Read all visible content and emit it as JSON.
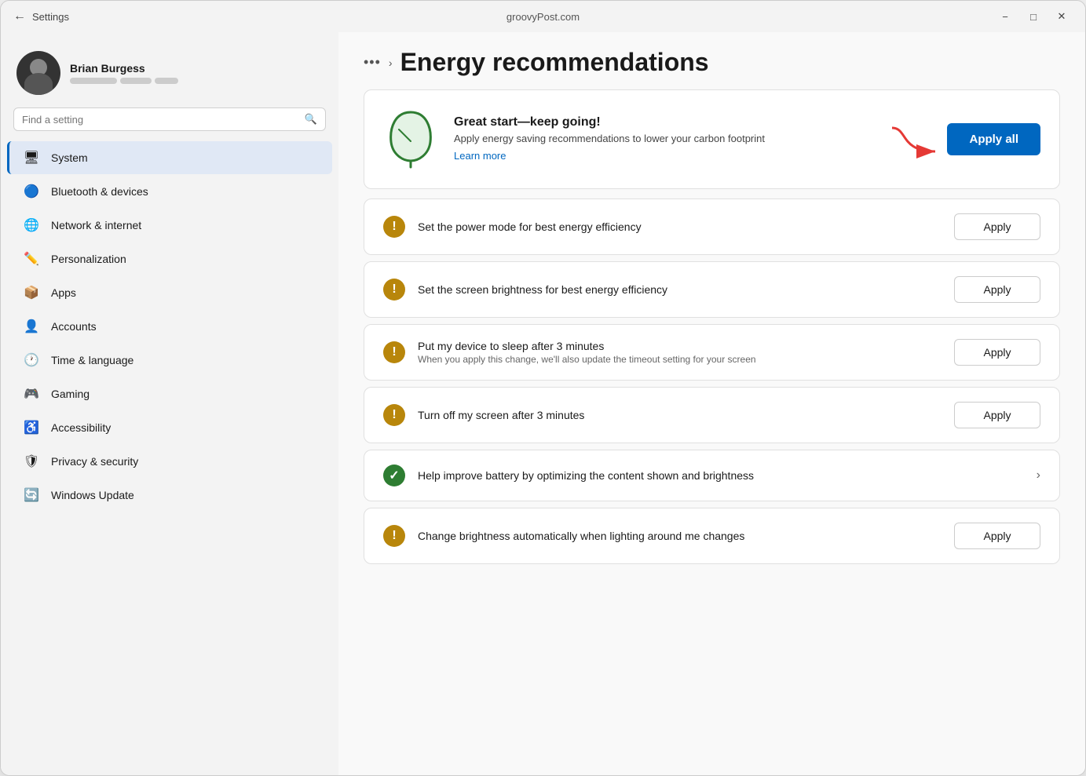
{
  "window": {
    "title": "groovyPost.com",
    "controls": {
      "minimize": "−",
      "maximize": "□",
      "close": "✕"
    }
  },
  "sidebar": {
    "user": {
      "name": "Brian Burgess",
      "bars": [
        60,
        40,
        30
      ]
    },
    "search": {
      "placeholder": "Find a setting"
    },
    "nav": [
      {
        "id": "system",
        "label": "System",
        "icon": "🖥",
        "active": true
      },
      {
        "id": "bluetooth",
        "label": "Bluetooth & devices",
        "icon": "🔵"
      },
      {
        "id": "network",
        "label": "Network & internet",
        "icon": "🌐"
      },
      {
        "id": "personalization",
        "label": "Personalization",
        "icon": "✏️"
      },
      {
        "id": "apps",
        "label": "Apps",
        "icon": "📦"
      },
      {
        "id": "accounts",
        "label": "Accounts",
        "icon": "👤"
      },
      {
        "id": "time",
        "label": "Time & language",
        "icon": "🕐"
      },
      {
        "id": "gaming",
        "label": "Gaming",
        "icon": "🎮"
      },
      {
        "id": "accessibility",
        "label": "Accessibility",
        "icon": "♿"
      },
      {
        "id": "privacy",
        "label": "Privacy & security",
        "icon": "🛡"
      },
      {
        "id": "update",
        "label": "Windows Update",
        "icon": "🔄"
      }
    ]
  },
  "main": {
    "breadcrumb_dots": "•••",
    "breadcrumb_arrow": "›",
    "page_title": "Energy recommendations",
    "energy_card": {
      "title": "Great start—keep going!",
      "description": "Apply energy saving recommendations to lower your carbon footprint",
      "learn_more": "Learn more",
      "apply_all_label": "Apply all"
    },
    "recommendations": [
      {
        "id": "power-mode",
        "icon_type": "warning",
        "title": "Set the power mode for best energy efficiency",
        "subtitle": "",
        "has_apply": true,
        "has_chevron": false
      },
      {
        "id": "screen-brightness",
        "icon_type": "warning",
        "title": "Set the screen brightness for best energy efficiency",
        "subtitle": "",
        "has_apply": true,
        "has_chevron": false
      },
      {
        "id": "sleep",
        "icon_type": "warning",
        "title": "Put my device to sleep after 3 minutes",
        "subtitle": "When you apply this change, we'll also update the timeout setting for your screen",
        "has_apply": true,
        "has_chevron": false
      },
      {
        "id": "screen-off",
        "icon_type": "warning",
        "title": "Turn off my screen after 3 minutes",
        "subtitle": "",
        "has_apply": true,
        "has_chevron": false
      },
      {
        "id": "battery-optimize",
        "icon_type": "success",
        "title": "Help improve battery by optimizing the content shown and brightness",
        "subtitle": "",
        "has_apply": false,
        "has_chevron": true
      },
      {
        "id": "auto-brightness",
        "icon_type": "warning",
        "title": "Change brightness automatically when lighting around me changes",
        "subtitle": "",
        "has_apply": true,
        "has_chevron": false
      }
    ],
    "apply_label": "Apply"
  }
}
